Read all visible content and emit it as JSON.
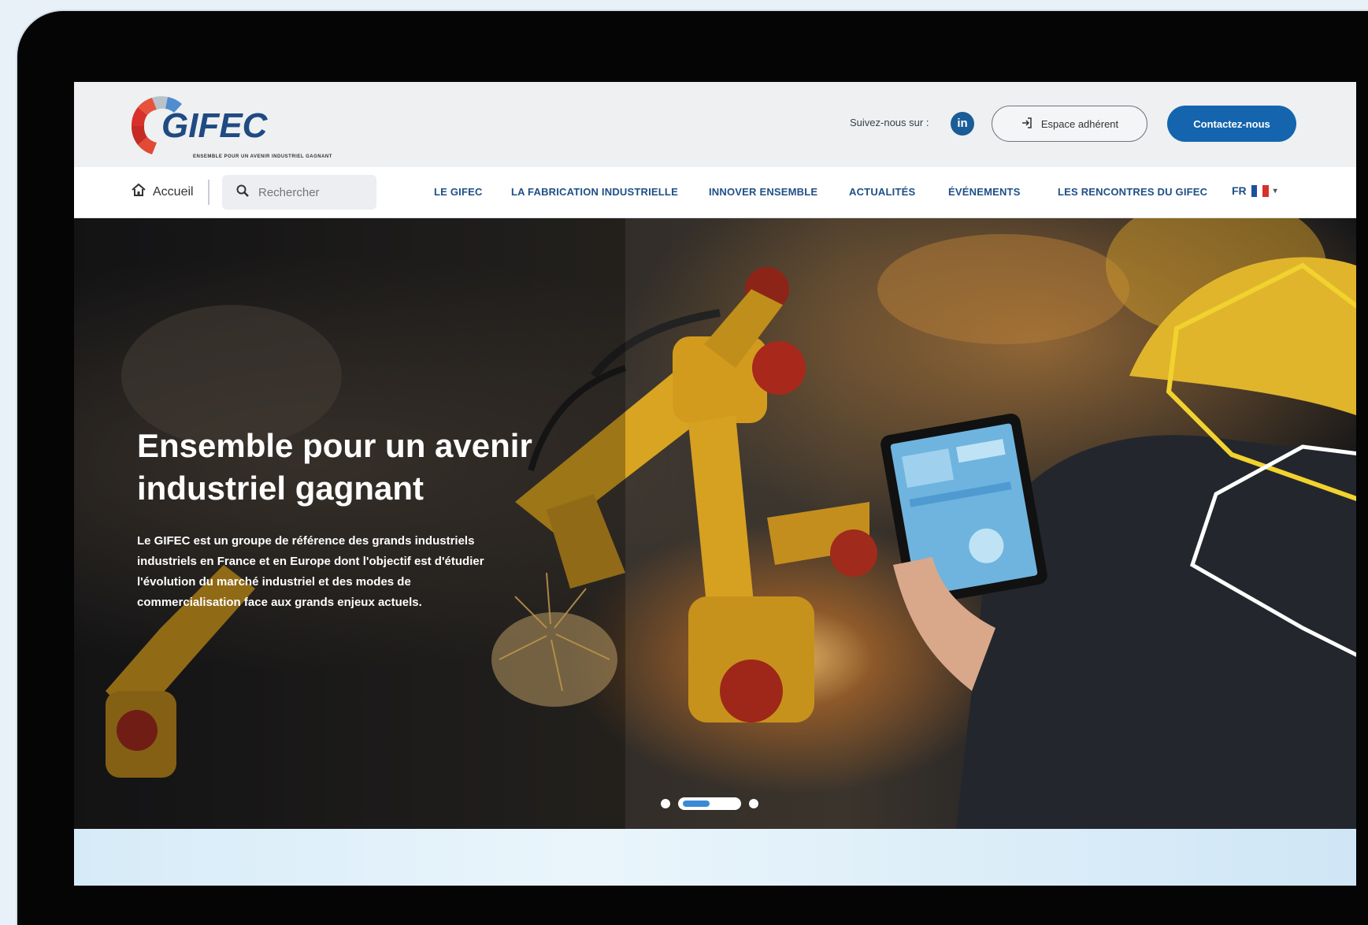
{
  "header": {
    "logo_text": "GIFEC",
    "tagline": "Ensemble pour un avenir industriel gagnant",
    "follow_label": "Suivez-nous sur :",
    "linkedin_icon": "linkedin-icon",
    "member_label": "Espace adhérent",
    "contact_label": "Contactez-nous"
  },
  "nav": {
    "home_label": "Accueil",
    "search_placeholder": "Rechercher",
    "items": [
      "LE GIFEC",
      "LA FABRICATION INDUSTRIELLE",
      "INNOVER ENSEMBLE",
      "ACTUALITÉS",
      "ÉVÉNEMENTS",
      "LES RENCONTRES DU GIFEC"
    ],
    "language": "FR"
  },
  "hero": {
    "title": "Ensemble pour un avenir industriel gagnant",
    "text": "Le GIFEC est un groupe de référence des grands industriels industriels en France et en Europe dont l'objectif est d'étudier l'évolution du marché industriel et des modes de commercialisation face aux grands enjeux actuels.",
    "slides_total": 3,
    "active_slide": 2
  },
  "colors": {
    "brand_blue": "#1465ae",
    "brand_red": "#d8302a",
    "accent_yellow": "#f2d22e"
  }
}
